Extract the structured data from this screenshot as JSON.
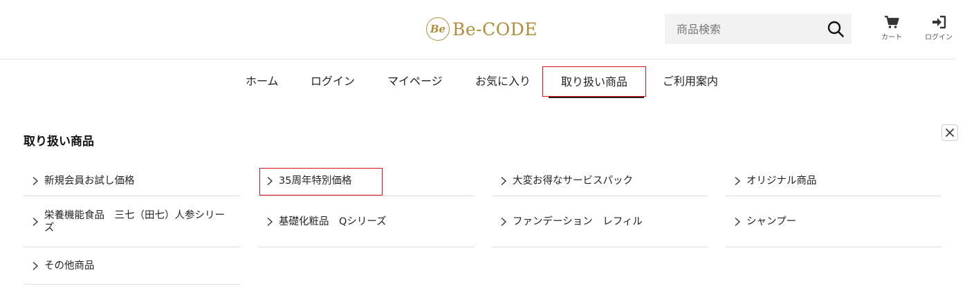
{
  "header": {
    "logo_mark": "Be",
    "logo_text": "Be-CODE",
    "search_placeholder": "商品検索",
    "cart_label": "カート",
    "login_label": "ログイン"
  },
  "nav": {
    "items": [
      {
        "label": "ホーム"
      },
      {
        "label": "ログイン"
      },
      {
        "label": "マイページ"
      },
      {
        "label": "お気に入り"
      },
      {
        "label": "取り扱い商品"
      },
      {
        "label": "ご利用案内"
      }
    ],
    "active_index": 4
  },
  "panel": {
    "title": "取り扱い商品",
    "categories": [
      {
        "label": "新規会員お試し価格"
      },
      {
        "label": "35周年特別価格"
      },
      {
        "label": "大変お得なサービスパック"
      },
      {
        "label": "オリジナル商品"
      },
      {
        "label": "栄養機能食品　三七（田七）人参シリーズ"
      },
      {
        "label": "基礎化粧品　Qシリーズ"
      },
      {
        "label": "ファンデーション　レフィル"
      },
      {
        "label": "シャンプー"
      },
      {
        "label": "その他商品"
      }
    ]
  },
  "colors": {
    "brand_gold": "#b08d3a",
    "highlight_red": "#e0101a"
  }
}
